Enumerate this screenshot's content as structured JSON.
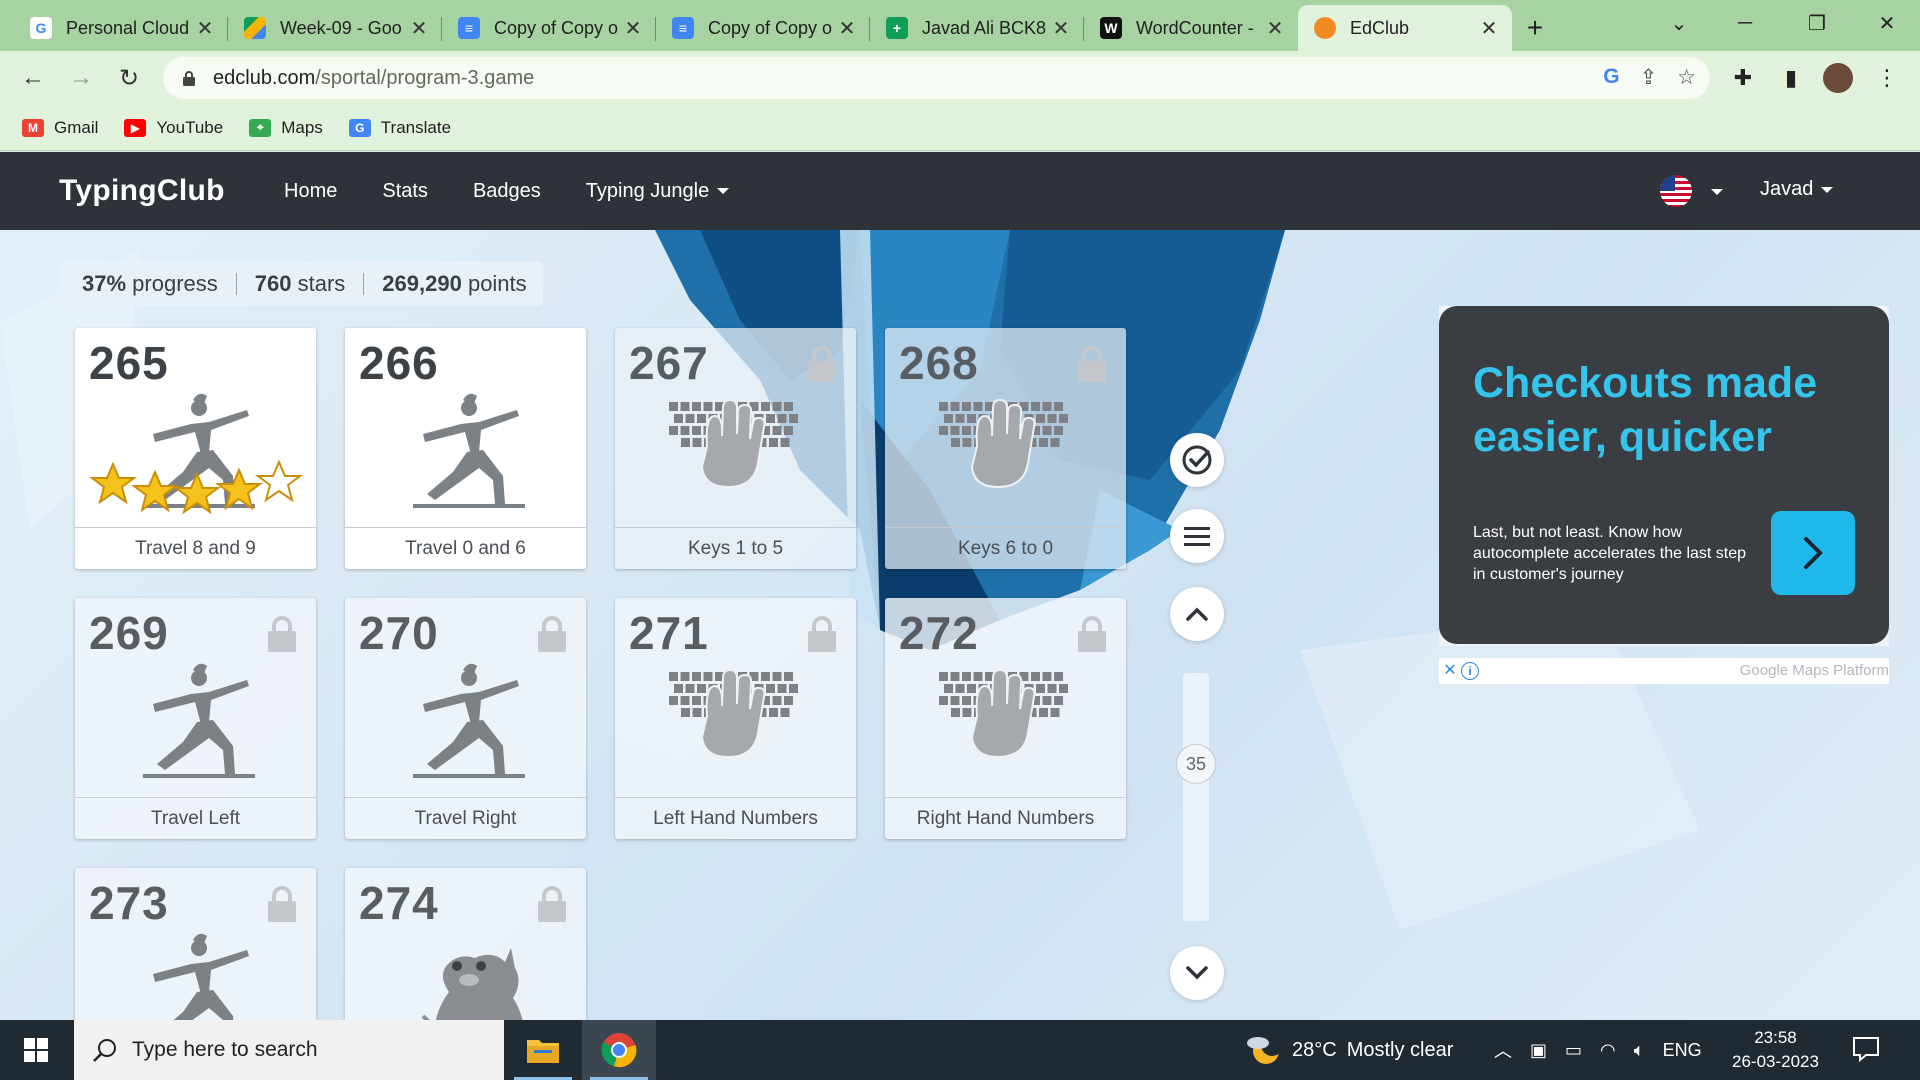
{
  "browser": {
    "tabs": [
      {
        "title": "Personal Cloud",
        "favicon": "google-icon",
        "color": "#ffffff"
      },
      {
        "title": "Week-09 - Goo",
        "favicon": "drive-icon",
        "color": "#ffffff"
      },
      {
        "title": "Copy of Copy o",
        "favicon": "docs-icon",
        "color": "#4285f4"
      },
      {
        "title": "Copy of Copy o",
        "favicon": "docs-icon",
        "color": "#4285f4"
      },
      {
        "title": "Javad Ali BCK8",
        "favicon": "sheets-icon",
        "color": "#0f9d58"
      },
      {
        "title": "WordCounter -",
        "favicon": "wordcounter-icon",
        "color": "#111111"
      },
      {
        "title": "EdClub",
        "favicon": "edclub-icon",
        "color": "#f08a24"
      }
    ],
    "active_tab_index": 6,
    "url_host": "edclub.com",
    "url_path": "/sportal/program-3.game",
    "bookmarks": [
      {
        "label": "Gmail",
        "icon": "gmail-icon",
        "color": "#ea4335"
      },
      {
        "label": "YouTube",
        "icon": "youtube-icon",
        "color": "#ff0000"
      },
      {
        "label": "Maps",
        "icon": "maps-icon",
        "color": "#34a853"
      },
      {
        "label": "Translate",
        "icon": "translate-icon",
        "color": "#4285f4"
      }
    ],
    "colors": {
      "frame": "#a7d3a2",
      "toolbar": "#e1f2dc"
    }
  },
  "site": {
    "brand": "TypingClub",
    "nav": [
      "Home",
      "Stats",
      "Badges",
      "Typing Jungle"
    ],
    "user": "Javad",
    "colors": {
      "navbar": "#2d3338"
    }
  },
  "progress": {
    "percent": "37%",
    "percent_label": "progress",
    "stars": "760",
    "stars_label": "stars",
    "points": "269,290",
    "points_label": "points"
  },
  "lessons": [
    {
      "num": "265",
      "label": "Travel 8 and 9",
      "art": "yoga",
      "locked": false,
      "stars": 5,
      "filled_stars": 4
    },
    {
      "num": "266",
      "label": "Travel 0 and 6",
      "art": "yoga",
      "locked": false
    },
    {
      "num": "267",
      "label": "Keys 1 to 5",
      "art": "keyboard",
      "locked": true,
      "dim": true
    },
    {
      "num": "268",
      "label": "Keys 6 to 0",
      "art": "keyboard",
      "locked": true,
      "dim": true
    },
    {
      "num": "269",
      "label": "Travel Left",
      "art": "yoga",
      "locked": true
    },
    {
      "num": "270",
      "label": "Travel Right",
      "art": "yoga",
      "locked": true
    },
    {
      "num": "271",
      "label": "Left Hand Numbers",
      "art": "keyboard",
      "locked": true
    },
    {
      "num": "272",
      "label": "Right Hand Numbers",
      "art": "keyboard",
      "locked": true
    },
    {
      "num": "273",
      "label": "",
      "art": "yoga",
      "locked": true
    },
    {
      "num": "274",
      "label": "",
      "art": "monster",
      "locked": true
    }
  ],
  "scroller": {
    "position_label": "35"
  },
  "ad": {
    "title": "Checkouts made easier, quicker",
    "body": "Last, but not least. Know how autocomplete accelerates the last step in customer's journey",
    "source": "Google Maps Platform",
    "colors": {
      "bg": "#3a3d41",
      "accent": "#34c4ec",
      "cta": "#1fb8ea"
    }
  },
  "taskbar": {
    "search_placeholder": "Type here to search",
    "temperature": "28°C",
    "weather": "Mostly clear",
    "language": "ENG",
    "time": "23:58",
    "date": "26-03-2023"
  }
}
